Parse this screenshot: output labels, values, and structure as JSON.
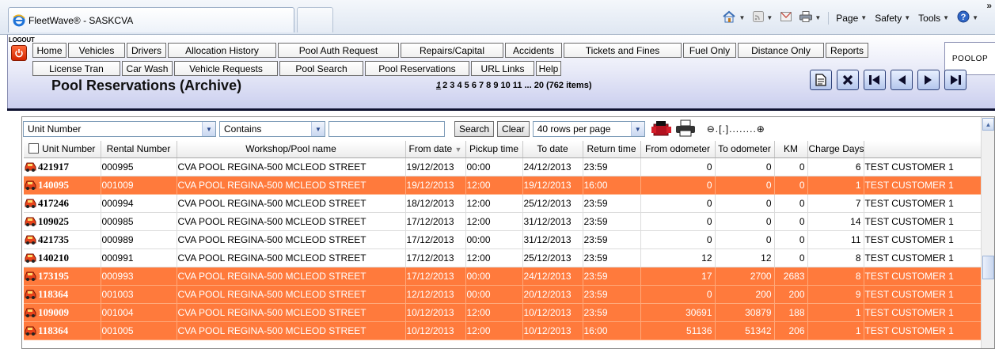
{
  "browser": {
    "tab_title": "FleetWave® - SASKCVA",
    "commands": [
      "Page",
      "Safety",
      "Tools"
    ]
  },
  "app": {
    "logout_label": "LOGOUT",
    "role_label": "POOLOP",
    "nav_row1": [
      "Home",
      "Vehicles",
      "Drivers",
      "Allocation History",
      "Pool Auth Request",
      "Repairs/Capital",
      "Accidents",
      "Tickets and Fines",
      "Fuel Only",
      "Distance Only",
      "Reports"
    ],
    "nav_row2": [
      "License Tran",
      "Car Wash",
      "Vehicle Requests",
      "Pool Search",
      "Pool Reservations",
      "URL Links",
      "Help"
    ],
    "page_title": "Pool Reservations (Archive)",
    "pager": {
      "current": "1",
      "rest": "2 3 4 5 6 7 8 9 10 11 ... 20 (762 items)"
    }
  },
  "filter": {
    "field": "Unit Number",
    "operator": "Contains",
    "value": "",
    "search_label": "Search",
    "clear_label": "Clear",
    "rows_per_page": "40 rows per page",
    "zoom": "⊖.[.]........⊕"
  },
  "table": {
    "columns": [
      "Unit Number",
      "Rental Number",
      "Workshop/Pool name",
      "From date",
      "Pickup time",
      "To date",
      "Return time",
      "From odometer",
      "To odometer",
      "KM",
      "Charge Days",
      ""
    ],
    "rows": [
      {
        "unit": "421917",
        "rental": "000995",
        "pool": "CVA POOL REGINA-500 MCLEOD STREET",
        "from": "19/12/2013",
        "pickup": "00:00",
        "to": "24/12/2013",
        "return": "23:59",
        "from_odo": "0",
        "to_odo": "0",
        "km": "0",
        "days": "6",
        "customer": "TEST CUSTOMER 1",
        "highlight": false
      },
      {
        "unit": "140095",
        "rental": "001009",
        "pool": "CVA POOL REGINA-500 MCLEOD STREET",
        "from": "19/12/2013",
        "pickup": "12:00",
        "to": "19/12/2013",
        "return": "16:00",
        "from_odo": "0",
        "to_odo": "0",
        "km": "0",
        "days": "1",
        "customer": "TEST CUSTOMER 1",
        "highlight": true
      },
      {
        "unit": "417246",
        "rental": "000994",
        "pool": "CVA POOL REGINA-500 MCLEOD STREET",
        "from": "18/12/2013",
        "pickup": "12:00",
        "to": "25/12/2013",
        "return": "23:59",
        "from_odo": "0",
        "to_odo": "0",
        "km": "0",
        "days": "7",
        "customer": "TEST CUSTOMER 1",
        "highlight": false
      },
      {
        "unit": "109025",
        "rental": "000985",
        "pool": "CVA POOL REGINA-500 MCLEOD STREET",
        "from": "17/12/2013",
        "pickup": "12:00",
        "to": "31/12/2013",
        "return": "23:59",
        "from_odo": "0",
        "to_odo": "0",
        "km": "0",
        "days": "14",
        "customer": "TEST CUSTOMER 1",
        "highlight": false
      },
      {
        "unit": "421735",
        "rental": "000989",
        "pool": "CVA POOL REGINA-500 MCLEOD STREET",
        "from": "17/12/2013",
        "pickup": "00:00",
        "to": "31/12/2013",
        "return": "23:59",
        "from_odo": "0",
        "to_odo": "0",
        "km": "0",
        "days": "11",
        "customer": "TEST CUSTOMER 1",
        "highlight": false
      },
      {
        "unit": "140210",
        "rental": "000991",
        "pool": "CVA POOL REGINA-500 MCLEOD STREET",
        "from": "17/12/2013",
        "pickup": "12:00",
        "to": "25/12/2013",
        "return": "23:59",
        "from_odo": "12",
        "to_odo": "12",
        "km": "0",
        "days": "8",
        "customer": "TEST CUSTOMER 1",
        "highlight": false
      },
      {
        "unit": "173195",
        "rental": "000993",
        "pool": "CVA POOL REGINA-500 MCLEOD STREET",
        "from": "17/12/2013",
        "pickup": "00:00",
        "to": "24/12/2013",
        "return": "23:59",
        "from_odo": "17",
        "to_odo": "2700",
        "km": "2683",
        "days": "8",
        "customer": "TEST CUSTOMER 1",
        "highlight": true
      },
      {
        "unit": "118364",
        "rental": "001003",
        "pool": "CVA POOL REGINA-500 MCLEOD STREET",
        "from": "12/12/2013",
        "pickup": "00:00",
        "to": "20/12/2013",
        "return": "23:59",
        "from_odo": "0",
        "to_odo": "200",
        "km": "200",
        "days": "9",
        "customer": "TEST CUSTOMER 1",
        "highlight": true
      },
      {
        "unit": "109009",
        "rental": "001004",
        "pool": "CVA POOL REGINA-500 MCLEOD STREET",
        "from": "10/12/2013",
        "pickup": "12:00",
        "to": "10/12/2013",
        "return": "23:59",
        "from_odo": "30691",
        "to_odo": "30879",
        "km": "188",
        "days": "1",
        "customer": "TEST CUSTOMER 1",
        "highlight": true
      },
      {
        "unit": "118364",
        "rental": "001005",
        "pool": "CVA POOL REGINA-500 MCLEOD STREET",
        "from": "10/12/2013",
        "pickup": "12:00",
        "to": "10/12/2013",
        "return": "16:00",
        "from_odo": "51136",
        "to_odo": "51342",
        "km": "206",
        "days": "1",
        "customer": "TEST CUSTOMER 1",
        "highlight": true
      }
    ]
  },
  "colors": {
    "highlight_row": "#ff7a3c",
    "header_gradient_end": "#c9cdee"
  },
  "icons": [
    "ie-logo-icon",
    "home-icon",
    "feeds-icon",
    "mail-icon",
    "print-icon",
    "help-icon",
    "power-icon",
    "document-icon",
    "delete-icon",
    "first-page-icon",
    "prev-page-icon",
    "next-page-icon",
    "last-page-icon",
    "export-icon",
    "print-icon",
    "car-icon"
  ]
}
